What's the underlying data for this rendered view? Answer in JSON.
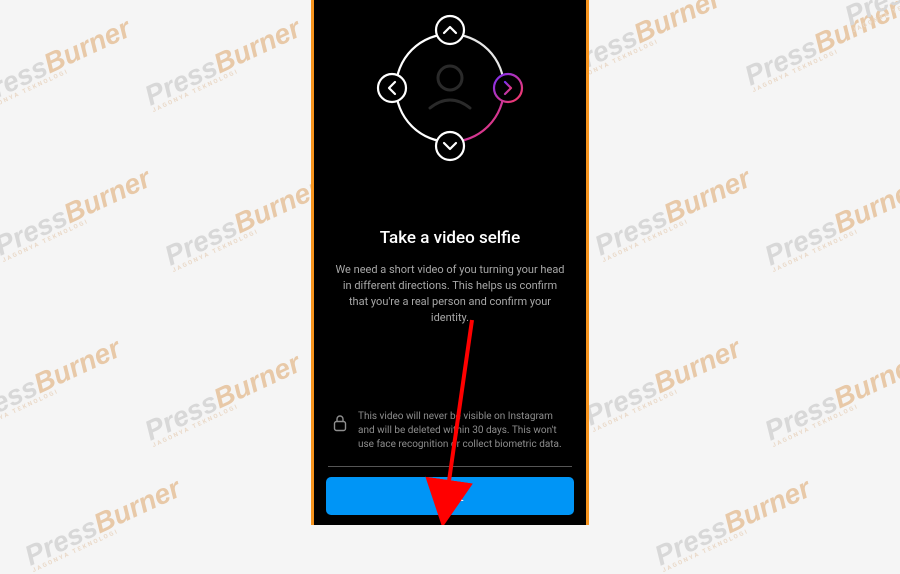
{
  "watermark": {
    "brand_part1": "Press",
    "brand_part2": "Burner",
    "tagline": "JAGONYA TEKNOLOGI"
  },
  "screen": {
    "title": "Take a video selfie",
    "description": "We need a short video of you turning your head in different directions. This helps us confirm that you're a real person and confirm your identity.",
    "privacy_note": "This video will never be visible on Instagram and will be deleted within 30 days. This won't use face recognition or collect biometric data.",
    "next_button_label": "Next"
  },
  "colors": {
    "accent_button": "#0095f6",
    "frame_border": "#f7941d",
    "annotation_arrow": "#ff0000",
    "gradient_start": "#7b2ff7",
    "gradient_end": "#ff3a5e"
  }
}
